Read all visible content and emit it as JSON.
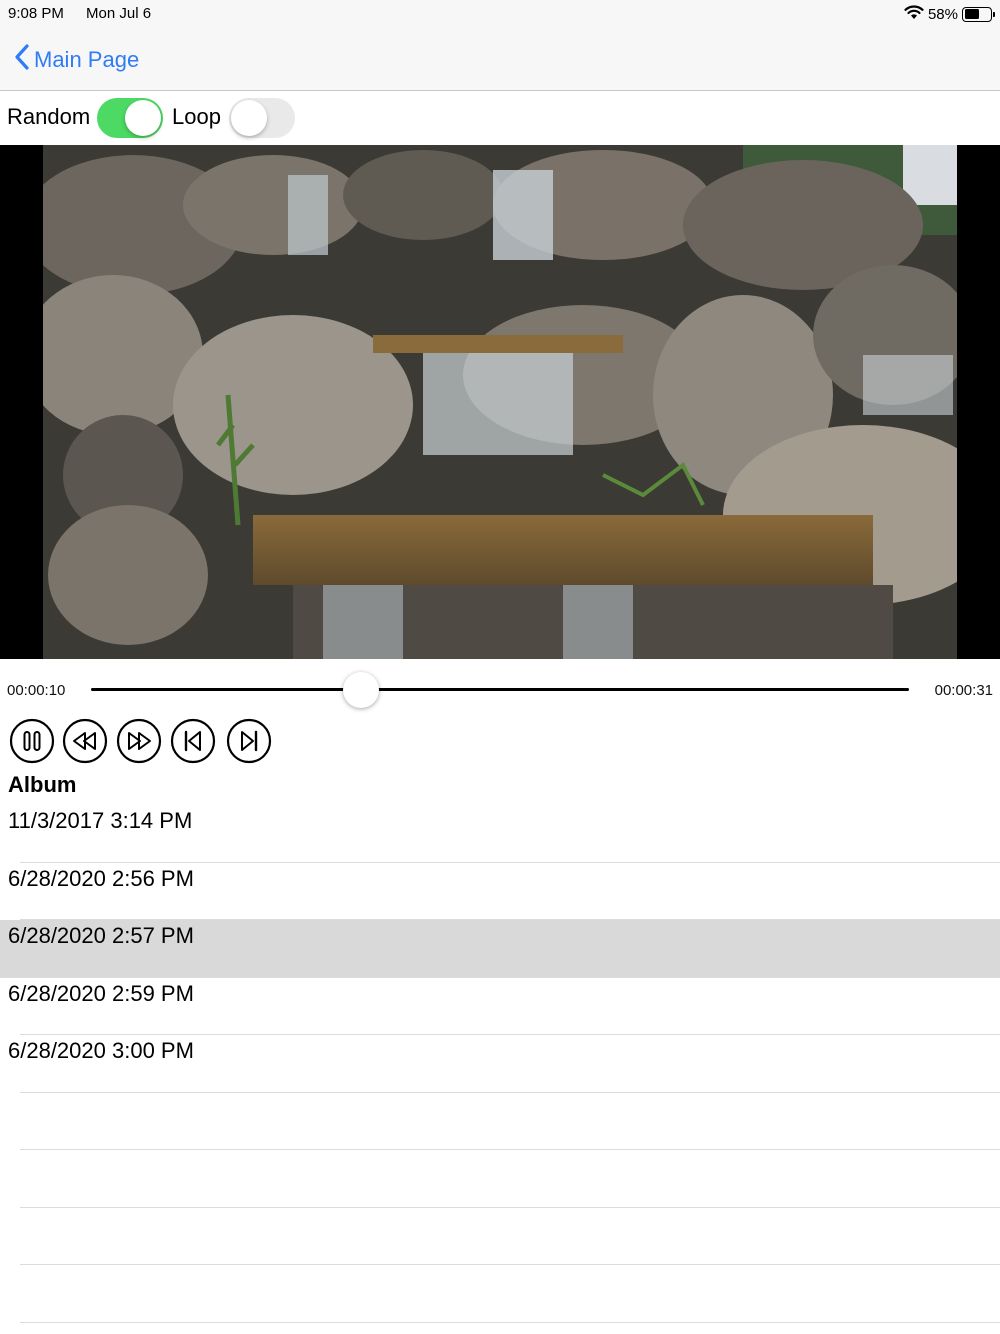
{
  "status_bar": {
    "time": "9:08 PM",
    "date": "Mon Jul 6",
    "battery": "58%",
    "battery_level": 0.58
  },
  "nav": {
    "back_label": "Main Page"
  },
  "toggles": {
    "random_label": "Random",
    "random_on": true,
    "loop_label": "Loop",
    "loop_on": false
  },
  "player": {
    "current_time": "00:00:10",
    "total_time": "00:00:31",
    "progress": 0.33
  },
  "controls": [
    "pause-icon",
    "rewind-icon",
    "fast-forward-icon",
    "skip-back-icon",
    "skip-forward-icon"
  ],
  "album": {
    "title": "Album",
    "items": [
      "11/3/2017 3:14 PM",
      "6/28/2020 2:56 PM",
      "6/28/2020 2:57 PM",
      "6/28/2020 2:59 PM",
      "6/28/2020 3:00 PM"
    ],
    "selected_index": 2
  },
  "colors": {
    "accent": "#2f7cf6",
    "switch_on": "#4cd964",
    "selected_row": "#d9d9d9"
  }
}
